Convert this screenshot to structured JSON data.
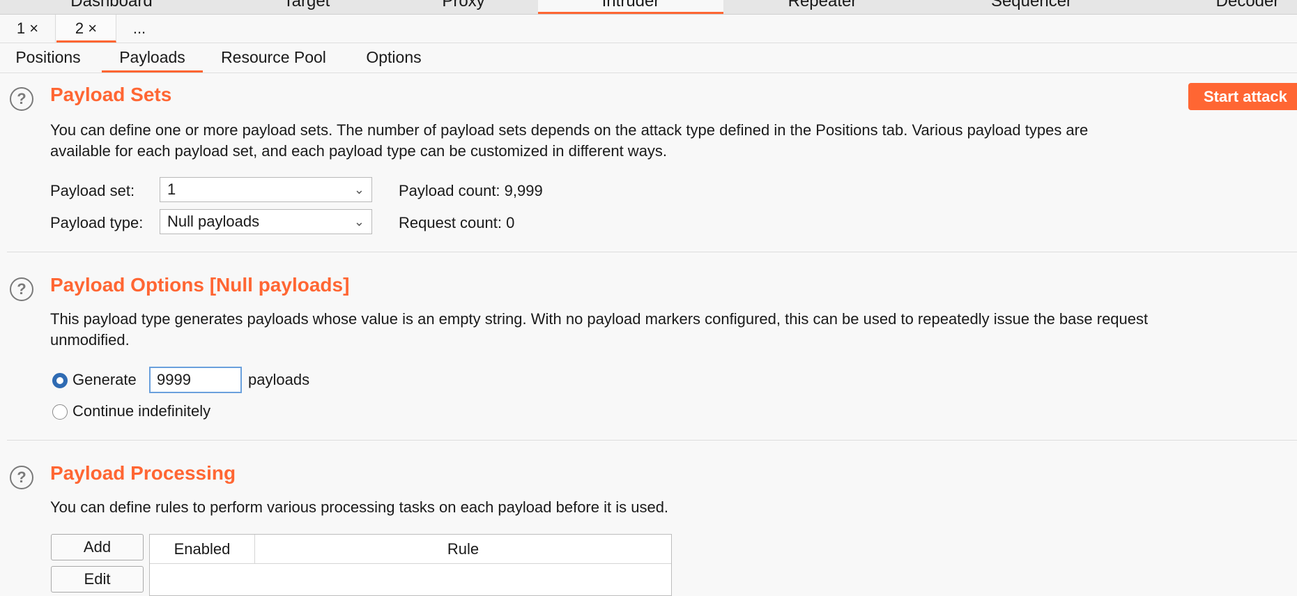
{
  "module_tabs": [
    {
      "label": "Dashboard"
    },
    {
      "label": "Target"
    },
    {
      "label": "Proxy"
    },
    {
      "label": "Intruder",
      "active": true
    },
    {
      "label": "Repeater"
    },
    {
      "label": "Sequencer"
    },
    {
      "label": "Decoder"
    }
  ],
  "attack_tabs": [
    {
      "label": "1 ×"
    },
    {
      "label": "2 ×",
      "active": true
    },
    {
      "label": "..."
    }
  ],
  "sub_tabs": [
    {
      "label": "Positions"
    },
    {
      "label": "Payloads",
      "active": true
    },
    {
      "label": "Resource Pool"
    },
    {
      "label": "Options"
    }
  ],
  "help_icon": "?",
  "start_attack_label": "Start attack",
  "payload_sets": {
    "title": "Payload Sets",
    "desc_line1": "You can define one or more payload sets. The number of payload sets depends on the attack type defined in the Positions tab. Various payload types are",
    "desc_line2": "available for each payload set, and each payload type can be customized in different ways.",
    "set_label": "Payload set:",
    "set_value": "1",
    "type_label": "Payload type:",
    "type_value": "Null payloads",
    "payload_count": "Payload count: 9,999",
    "request_count": "Request count: 0"
  },
  "payload_options": {
    "title": "Payload Options [Null payloads]",
    "desc_line1": "This payload type generates payloads whose value is an empty string. With no payload markers configured, this can be used to repeatedly issue the base request",
    "desc_line2": "unmodified.",
    "generate_label": "Generate",
    "generate_value": "9999",
    "payloads_suffix": "payloads",
    "continue_label": "Continue indefinitely"
  },
  "payload_processing": {
    "title": "Payload Processing",
    "desc": "You can define rules to perform various processing tasks on each payload before it is used.",
    "add_label": "Add",
    "edit_label": "Edit",
    "columns": [
      "Enabled",
      "Rule"
    ]
  },
  "colors": {
    "accent": "#ff6633",
    "radio_selected": "#2f6bb3"
  }
}
